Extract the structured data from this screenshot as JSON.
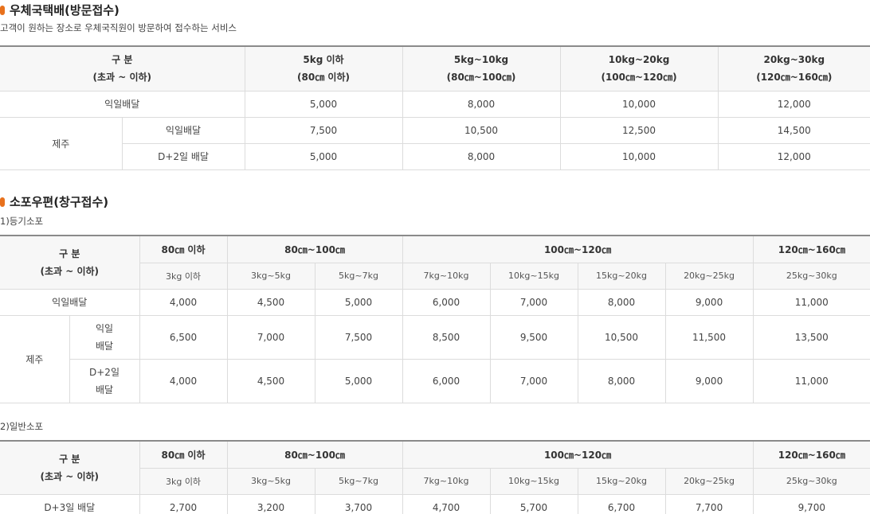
{
  "section1": {
    "title": "우체국택배(방문접수)",
    "desc": "고객이 원하는 장소로 우체국직원이 방문하여 접수하는 서비스",
    "header": {
      "label_top": "구 분",
      "label_bottom": "(초과 ~ 이하)",
      "cols": [
        {
          "top": "5kg 이하",
          "bottom": "(80㎝ 이하)"
        },
        {
          "top": "5kg~10kg",
          "bottom": "(80㎝~100㎝)"
        },
        {
          "top": "10kg~20kg",
          "bottom": "(100㎝~120㎝)"
        },
        {
          "top": "20kg~30kg",
          "bottom": "(120㎝~160㎝)"
        }
      ]
    },
    "rows": {
      "next_day": {
        "label": "익일배달",
        "values": [
          "5,000",
          "8,000",
          "10,000",
          "12,000"
        ]
      },
      "jeju": {
        "label": "제주",
        "next_day": {
          "label": "익일배달",
          "values": [
            "7,500",
            "10,500",
            "12,500",
            "14,500"
          ]
        },
        "d2": {
          "label": "D+2일 배달",
          "values": [
            "5,000",
            "8,000",
            "10,000",
            "12,000"
          ]
        }
      }
    }
  },
  "section2": {
    "title": "소포우편(창구접수)",
    "sub1": {
      "title": "1)등기소포",
      "header": {
        "label_top": "구 분",
        "label_bottom": "(초과 ~ 이하)",
        "groups": [
          "80㎝ 이하",
          "80㎝~100㎝",
          "100㎝~120㎝",
          "120㎝~160㎝"
        ],
        "weights": [
          "3kg 이하",
          "3kg~5kg",
          "5kg~7kg",
          "7kg~10kg",
          "10kg~15kg",
          "15kg~20kg",
          "20kg~25kg",
          "25kg~30kg"
        ]
      },
      "rows": {
        "next_day": {
          "label": "익일배달",
          "values": [
            "4,000",
            "4,500",
            "5,000",
            "6,000",
            "7,000",
            "8,000",
            "9,000",
            "11,000"
          ]
        },
        "jeju": {
          "label": "제주",
          "next_day": {
            "label_top": "익일",
            "label_bottom": "배달",
            "values": [
              "6,500",
              "7,000",
              "7,500",
              "8,500",
              "9,500",
              "10,500",
              "11,500",
              "13,500"
            ]
          },
          "d2": {
            "label_top": "D+2일",
            "label_bottom": "배달",
            "values": [
              "4,000",
              "4,500",
              "5,000",
              "6,000",
              "7,000",
              "8,000",
              "9,000",
              "11,000"
            ]
          }
        }
      }
    },
    "sub2": {
      "title": "2)일반소포",
      "header": {
        "label_top": "구 분",
        "label_bottom": "(초과 ~ 이하)",
        "groups": [
          "80㎝ 이하",
          "80㎝~100㎝",
          "100㎝~120㎝",
          "120㎝~160㎝"
        ],
        "weights": [
          "3kg 이하",
          "3kg~5kg",
          "5kg~7kg",
          "7kg~10kg",
          "10kg~15kg",
          "15kg~20kg",
          "20kg~25kg",
          "25kg~30kg"
        ]
      },
      "rows": {
        "d3": {
          "label": "D+3일 배달",
          "values": [
            "2,700",
            "3,200",
            "3,700",
            "4,700",
            "5,700",
            "6,700",
            "7,700",
            "9,700"
          ]
        }
      }
    }
  },
  "colors": {
    "accent": "#e8711c",
    "header_bg": "#f7f7f7",
    "border": "#dcdcdc",
    "top_rule": "#8a8a8a"
  }
}
